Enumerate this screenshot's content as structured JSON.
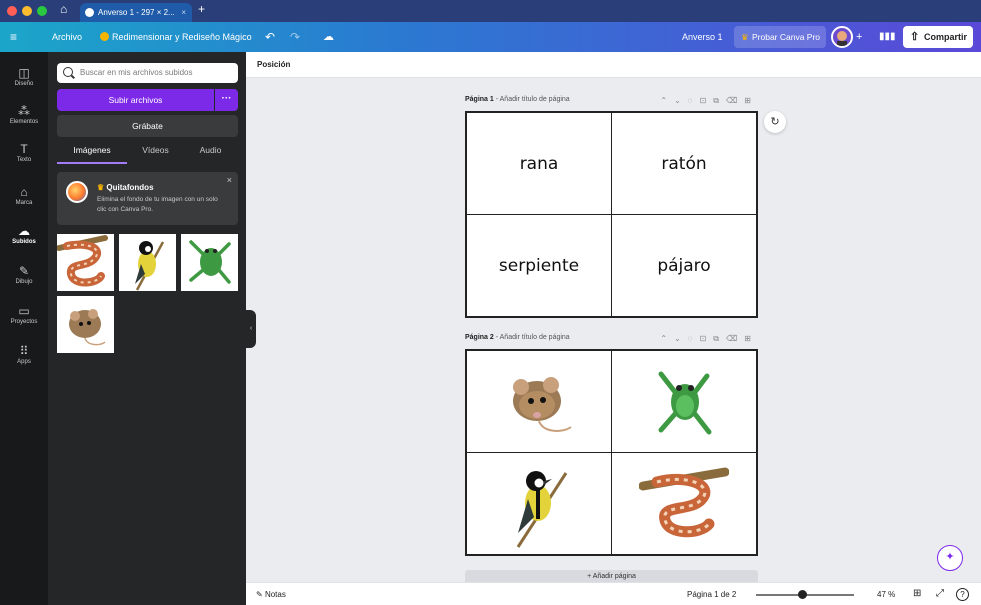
{
  "browser": {
    "tab_title": "Anverso 1 - 297 × 2...",
    "tab_close": "×",
    "new_tab": "+"
  },
  "header": {
    "menu_icon": "hamburger-icon",
    "file": "Archivo",
    "resize": "Redimensionar y Rediseño Mágico",
    "doc_title": "Anverso 1",
    "try_pro": "Probar Canva Pro",
    "plus": "+",
    "share": "Compartir",
    "colors": {
      "pro_crown": "#f7b500"
    }
  },
  "rail": {
    "items": [
      {
        "label": "Diseño",
        "icon": "layout-icon"
      },
      {
        "label": "Elementos",
        "icon": "shapes-icon"
      },
      {
        "label": "Texto",
        "icon": "text-icon"
      },
      {
        "label": "Marca",
        "icon": "brand-icon"
      },
      {
        "label": "Subidos",
        "icon": "cloud-upload-icon"
      },
      {
        "label": "Dibujo",
        "icon": "draw-icon"
      },
      {
        "label": "Proyectos",
        "icon": "folder-icon"
      },
      {
        "label": "Apps",
        "icon": "apps-grid-icon"
      }
    ],
    "active": "Subidos"
  },
  "panel": {
    "search_placeholder": "Buscar en mis archivos subidos",
    "upload": "Subir archivos",
    "upload_more": "···",
    "record": "Grábate",
    "tabs": [
      "Imágenes",
      "Vídeos",
      "Audio"
    ],
    "active_tab": "Imágenes",
    "promo": {
      "title": "Quitafondos",
      "description": "Elimina el fondo de tu imagen con un solo clic con Canva Pro.",
      "close": "×"
    },
    "uploads": [
      "snake",
      "bird",
      "frog",
      "mouse"
    ]
  },
  "canvas": {
    "position_label": "Posición",
    "pages": [
      {
        "label": "Página 1",
        "title_placeholder": "Añadir título de página",
        "cells": [
          "rana",
          "ratón",
          "serpiente",
          "pájaro"
        ]
      },
      {
        "label": "Página 2",
        "title_placeholder": "Añadir título de página",
        "cells": [
          "mouse",
          "frog",
          "bird",
          "snake"
        ]
      }
    ],
    "add_page": "+ Añadir página"
  },
  "footer": {
    "notes": "Notas",
    "page_indicator": "Página 1 de 2",
    "zoom": "47 %",
    "zoom_level": 0.47,
    "help": "?"
  }
}
